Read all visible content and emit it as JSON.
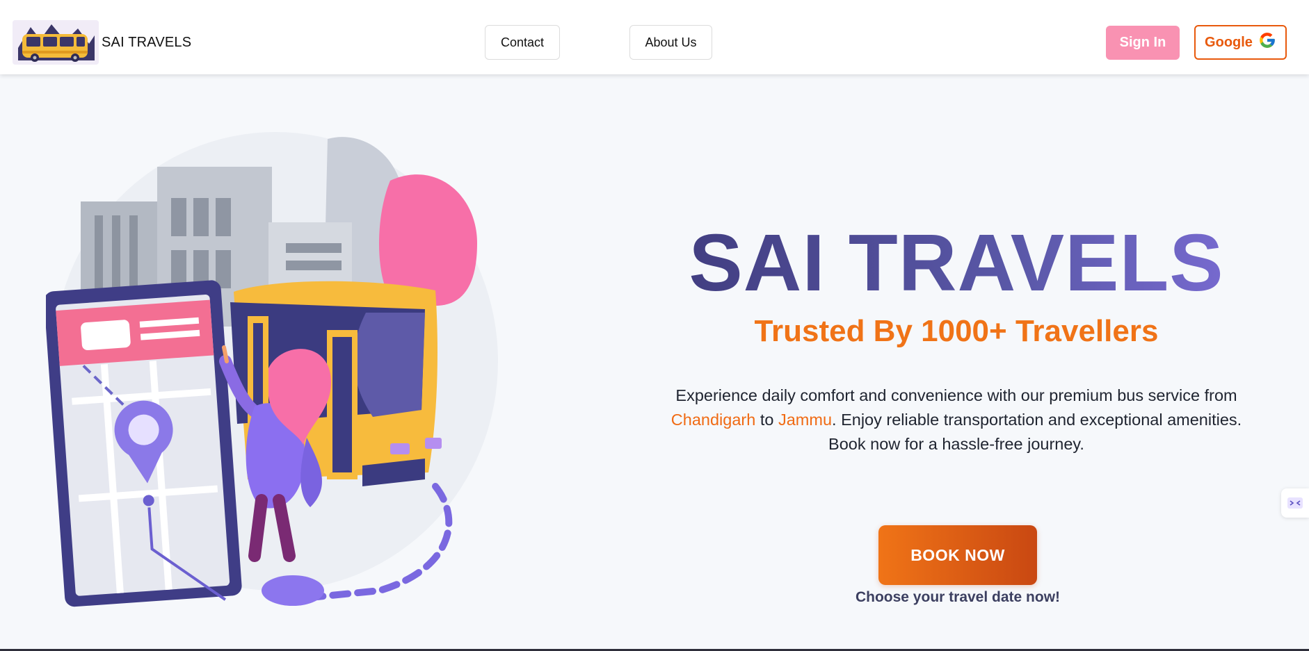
{
  "header": {
    "brand_name": "SAI TRAVELS",
    "nav": {
      "contact_label": "Contact",
      "about_label": "About Us"
    },
    "signin_label": "Sign In",
    "google_label": "Google"
  },
  "hero": {
    "title": "SAI TRAVELS",
    "subtitle": "Trusted By 1000+ Travellers",
    "desc_part1": "Experience daily comfort and convenience with our premium bus service from ",
    "desc_from": "Chandigarh",
    "desc_mid": " to ",
    "desc_to": "Jammu",
    "desc_part2": ". Enjoy reliable transportation and exceptional amenities. Book now for a hassle-free journey.",
    "book_label": "BOOK NOW",
    "book_note": "Choose your travel date now!"
  },
  "colors": {
    "accent_orange": "#f07317",
    "title_purple": "#4a4690",
    "signin_pink": "#f992b2",
    "google_orange": "#e8590c"
  },
  "icons": {
    "logo": "bus-logo",
    "google": "google-g-icon",
    "side_widget": "collapse-arrows-icon",
    "illustration": "bus-travel-illustration"
  }
}
